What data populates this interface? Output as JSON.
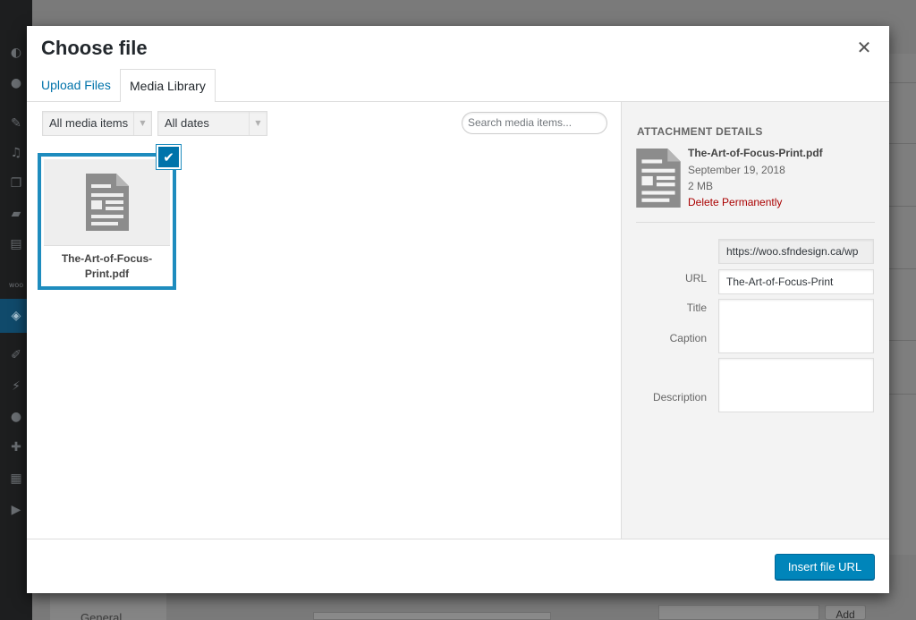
{
  "modal": {
    "title": "Choose file",
    "close_icon": "close-icon",
    "tabs": [
      {
        "label": "Upload Files",
        "active": false
      },
      {
        "label": "Media Library",
        "active": true
      }
    ]
  },
  "toolbar": {
    "type_filter": "All media items",
    "date_filter": "All dates",
    "search_placeholder": "Search media items..."
  },
  "attachments": [
    {
      "filename": "The-Art-of-Focus-Print.pdf",
      "filename_line1": "The-Art-of-Focus-",
      "filename_line2": "Print.pdf",
      "icon": "document-icon",
      "selected": true
    }
  ],
  "details": {
    "heading": "ATTACHMENT DETAILS",
    "filename": "The-Art-of-Focus-Print.pdf",
    "date": "September 19, 2018",
    "size": "2 MB",
    "delete_label": "Delete Permanently",
    "fields": {
      "url_label": "URL",
      "url_value": "https://woo.sfndesign.ca/wp",
      "title_label": "Title",
      "title_value": "The-Art-of-Focus-Print",
      "caption_label": "Caption",
      "caption_value": "",
      "description_label": "Description",
      "description_value": ""
    }
  },
  "footer": {
    "insert_label": "Insert file URL"
  },
  "background": {
    "menu_item": "General",
    "add_button": "Add"
  },
  "colors": {
    "accent": "#0073aa",
    "primary_button": "#0085ba",
    "delete": "#a00000",
    "selected_border": "#1e8cbe"
  }
}
